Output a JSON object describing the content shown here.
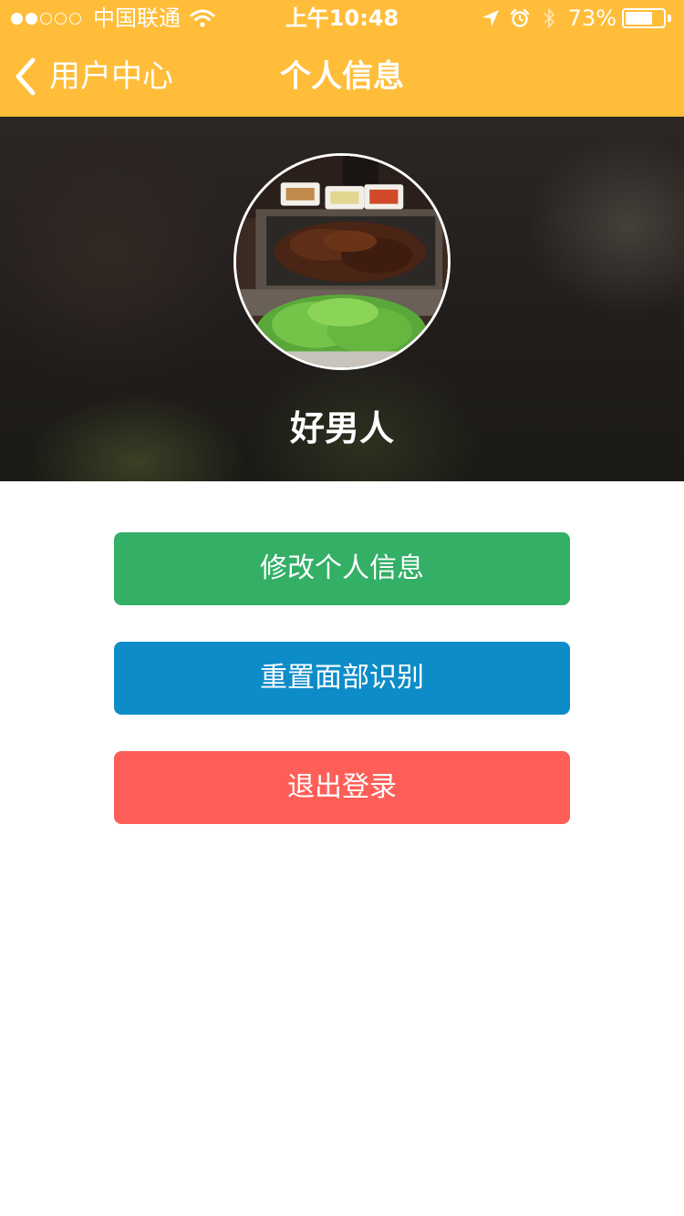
{
  "status_bar": {
    "carrier": "中国联通",
    "time": "上午10:48",
    "battery_percent": "73%",
    "battery_level": 0.73,
    "signal_strength": 2,
    "signal_total": 5,
    "icons": [
      "wifi-icon",
      "location-arrow-icon",
      "alarm-icon",
      "bluetooth-icon",
      "battery-icon"
    ]
  },
  "nav": {
    "back_label": "用户中心",
    "title": "个人信息",
    "background": "#FFBD39"
  },
  "profile": {
    "name": "好男人",
    "avatar": "food-photo-avatar"
  },
  "actions": [
    {
      "label": "修改个人信息",
      "color": "#33AF66"
    },
    {
      "label": "重置面部识别",
      "color": "#0E8CC8"
    },
    {
      "label": "退出登录",
      "color": "#FD5F58"
    }
  ]
}
